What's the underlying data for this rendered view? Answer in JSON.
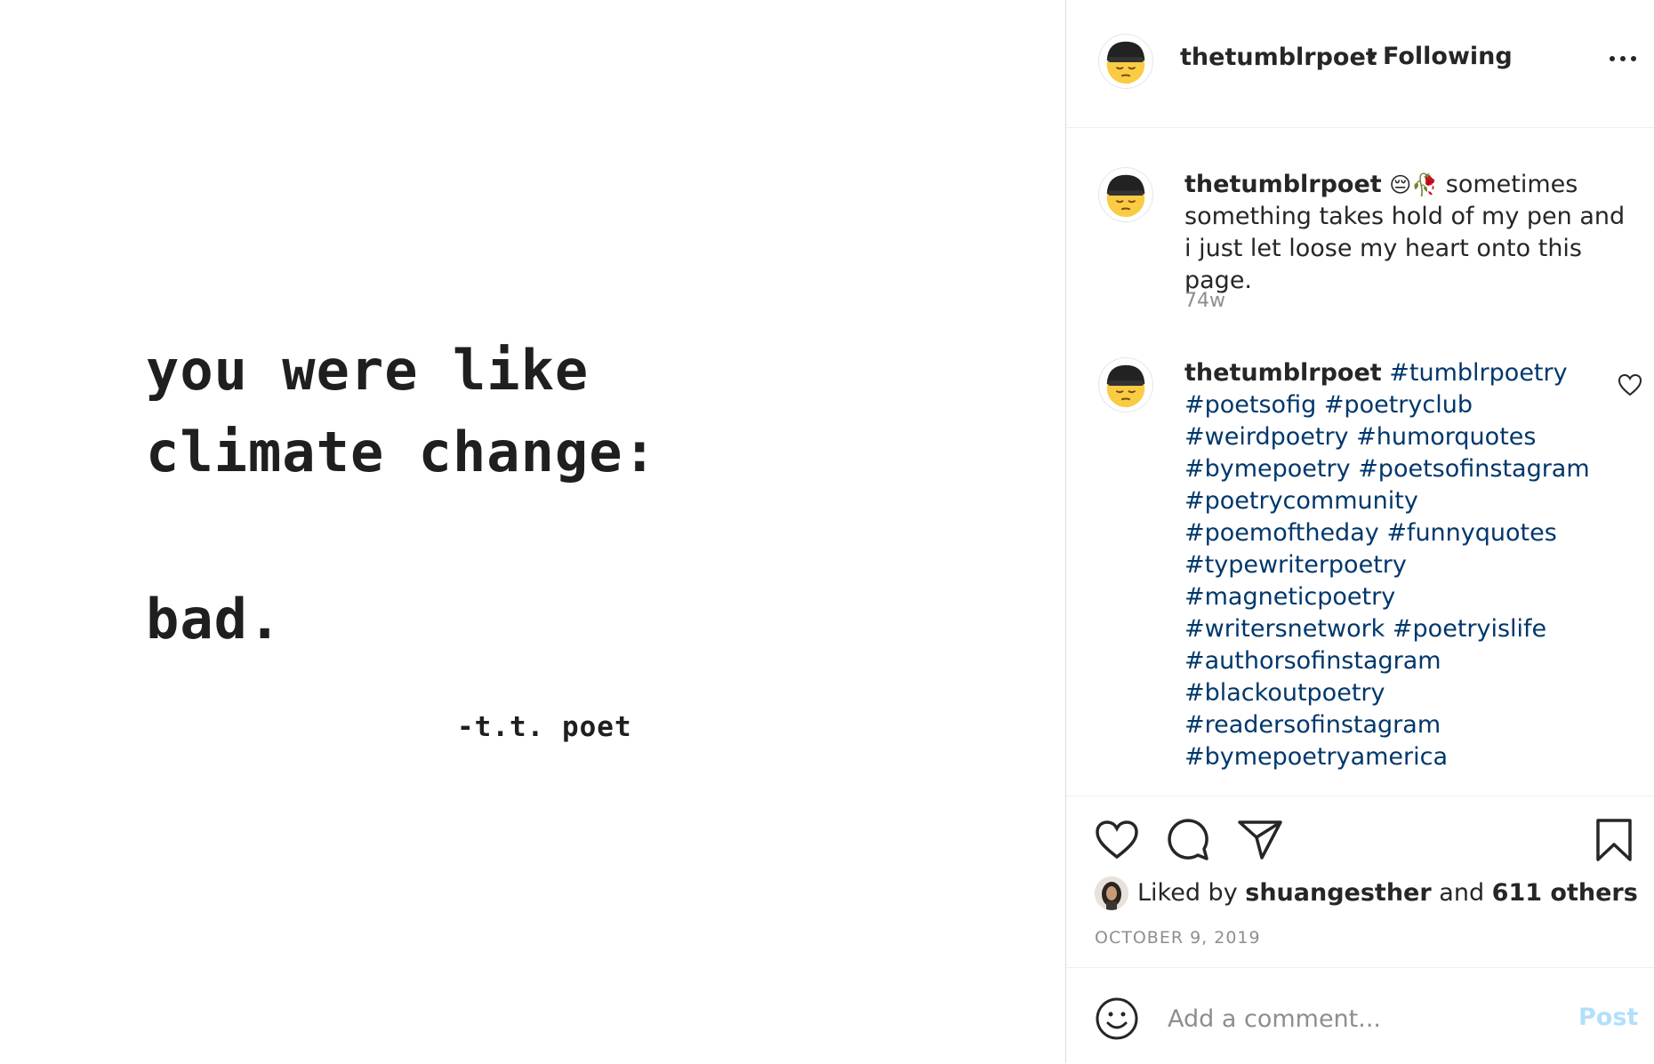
{
  "post_image": {
    "line1": "you were like",
    "line2": "climate change:",
    "line3": "bad.",
    "signature": "-t.t. poet"
  },
  "header": {
    "username": "thetumblrpoet",
    "separator": "•",
    "follow_status": "Following",
    "avatar_icon": "pensive-face-icon"
  },
  "caption": {
    "username": "thetumblrpoet",
    "emojis": "😔🥀",
    "text": " sometimes something takes hold of my pen and i just let loose my heart onto this page.",
    "age": "74w"
  },
  "comment": {
    "username": "thetumblrpoet",
    "hashtags": [
      "#tumblrpoetry",
      "#poetsofig",
      "#poetryclub",
      "#weirdpoetry",
      "#humorquotes",
      "#bymepoetry",
      "#poetsofinstagram",
      "#poetrycommunity",
      "#poemoftheday",
      "#funnyquotes",
      "#typewriterpoetry",
      "#magneticpoetry",
      "#writersnetwork",
      "#poetryislife",
      "#authorsofinstagram",
      "#blackoutpoetry",
      "#readersofinstagram",
      "#bymepoetryamerica"
    ]
  },
  "likes": {
    "prefix": "Liked by",
    "user": "shuangesther",
    "connector": "and",
    "others": "611 others"
  },
  "date": "OCTOBER 9, 2019",
  "add_comment": {
    "placeholder": "Add a comment...",
    "post_label": "Post"
  },
  "colors": {
    "hashtag": "#00376b",
    "text": "#262626",
    "muted": "#8e8e8e",
    "post_disabled": "#b2dffc",
    "border": "#dbdbdb"
  }
}
